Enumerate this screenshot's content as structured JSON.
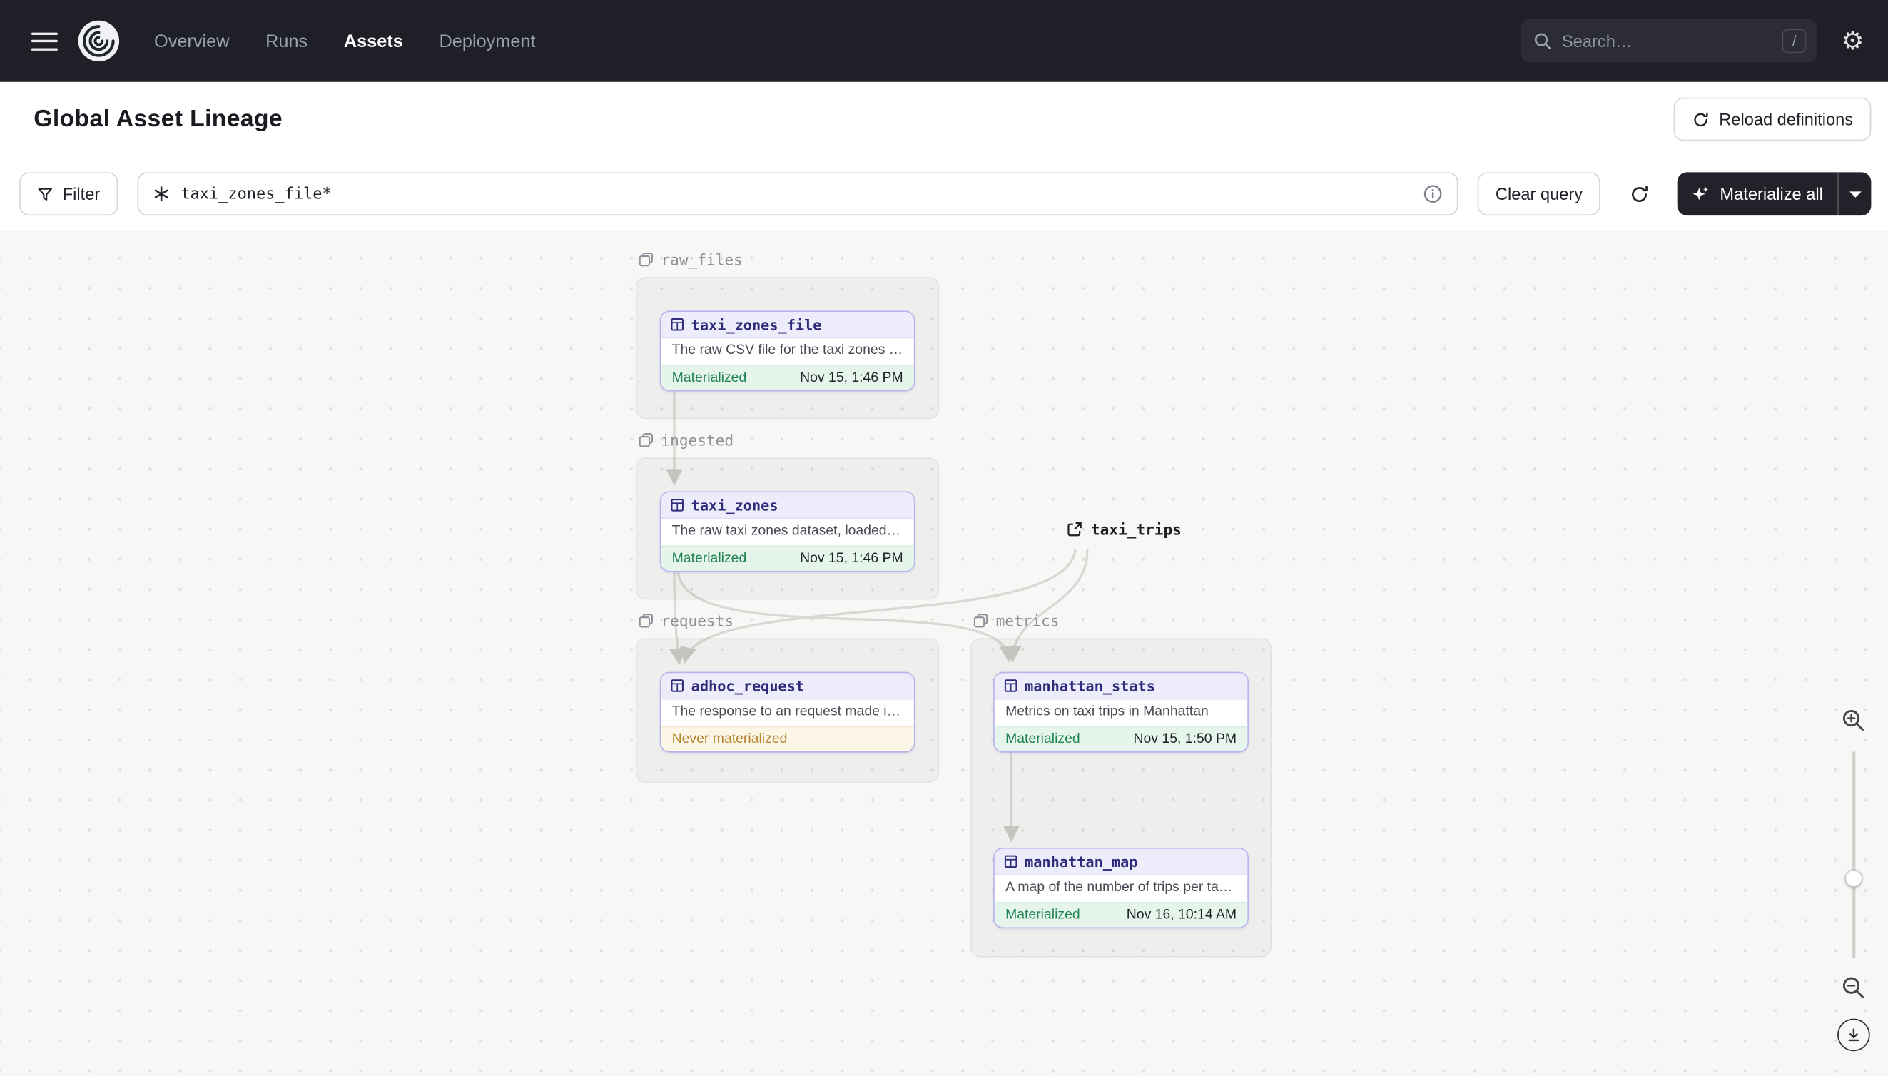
{
  "navbar": {
    "nav_items": [
      {
        "label": "Overview",
        "active": false
      },
      {
        "label": "Runs",
        "active": false
      },
      {
        "label": "Assets",
        "active": true
      },
      {
        "label": "Deployment",
        "active": false
      }
    ],
    "search": {
      "placeholder": "Search…",
      "shortcut": "/"
    }
  },
  "header": {
    "title": "Global Asset Lineage",
    "reload_label": "Reload definitions"
  },
  "toolbar": {
    "filter_label": "Filter",
    "query_value": "taxi_zones_file*",
    "clear_label": "Clear query",
    "materialize_label": "Materialize all"
  },
  "graph": {
    "groups": [
      {
        "name": "raw_files"
      },
      {
        "name": "ingested"
      },
      {
        "name": "requests"
      },
      {
        "name": "metrics"
      }
    ],
    "assets": [
      {
        "name": "taxi_zones_file",
        "group": "raw_files",
        "description": "The raw CSV file for the taxi zones dat…",
        "status": "Materialized",
        "timestamp": "Nov 15, 1:46 PM"
      },
      {
        "name": "taxi_zones",
        "group": "ingested",
        "description": "The raw taxi zones dataset, loaded int…",
        "status": "Materialized",
        "timestamp": "Nov 15, 1:46 PM"
      },
      {
        "name": "adhoc_request",
        "group": "requests",
        "description": "The response to an request made in th…",
        "status": "Never materialized"
      },
      {
        "name": "manhattan_stats",
        "group": "metrics",
        "description": "Metrics on taxi trips in Manhattan",
        "status": "Materialized",
        "timestamp": "Nov 15, 1:50 PM"
      },
      {
        "name": "manhattan_map",
        "group": "metrics",
        "description": "A map of the number of trips per taxi z…",
        "status": "Materialized",
        "timestamp": "Nov 16, 10:14 AM"
      }
    ],
    "external_assets": [
      {
        "name": "taxi_trips"
      }
    ],
    "edges": [
      {
        "from": "taxi_zones_file",
        "to": "taxi_zones"
      },
      {
        "from": "taxi_zones",
        "to": "adhoc_request"
      },
      {
        "from": "taxi_zones",
        "to": "manhattan_stats"
      },
      {
        "from": "taxi_trips",
        "to": "adhoc_request"
      },
      {
        "from": "taxi_trips",
        "to": "manhattan_stats"
      },
      {
        "from": "manhattan_stats",
        "to": "manhattan_map"
      }
    ]
  },
  "colors": {
    "navbar_bg": "#1f1f27",
    "materialized_green": "#1e8250",
    "never_materialized_amber": "#b8862f",
    "asset_border_purple": "#b9b5ec",
    "asset_name_indigo": "#312a7a",
    "edge_gray": "#d8d8d4"
  },
  "icons": {
    "menu": "hamburger",
    "logo": "dagster-swirl",
    "search": "magnifier",
    "settings": "gear",
    "reload": "circular-arrow",
    "filter": "funnel",
    "query": "asterisk-graph",
    "info": "circle-i",
    "materialize": "sparkle",
    "asset": "table-grid",
    "group": "layers",
    "external": "external-link",
    "zoom_in": "magnifier-plus",
    "zoom_out": "magnifier-minus",
    "download": "circle-arrow-down"
  }
}
